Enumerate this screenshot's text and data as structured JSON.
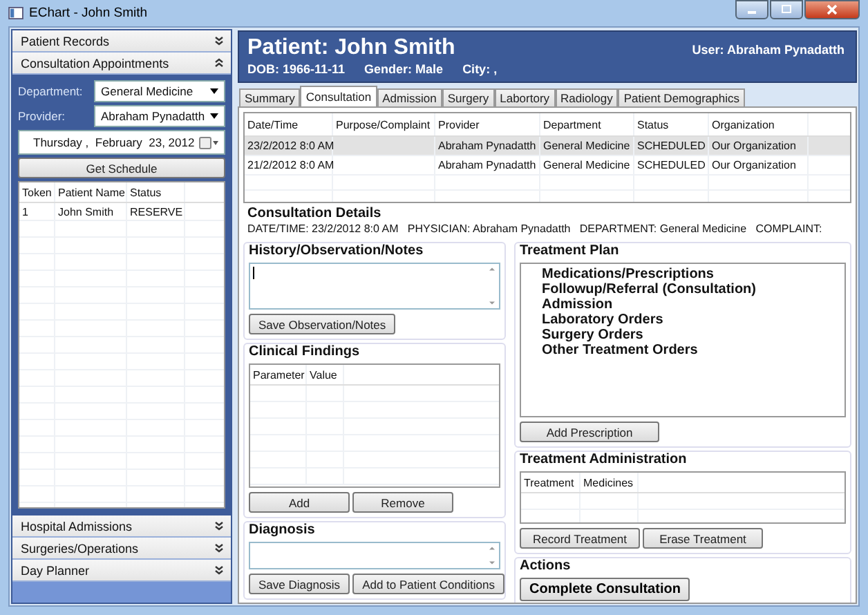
{
  "window": {
    "title": "EChart - John  Smith"
  },
  "sidebar": {
    "sections": [
      {
        "label": "Patient Records",
        "expanded": false
      },
      {
        "label": "Consultation Appointments",
        "expanded": true
      },
      {
        "label": "Hospital Admissions",
        "expanded": false
      },
      {
        "label": "Surgeries/Operations",
        "expanded": false
      },
      {
        "label": "Day Planner",
        "expanded": false
      }
    ],
    "department_label": "Department:",
    "department": "General Medicine",
    "provider_label": "Provider:",
    "provider": "Abraham Pynadatth",
    "date": "Thursday ,  February  23, 2012",
    "get_schedule": "Get Schedule",
    "appointments": {
      "columns": [
        "Token",
        "Patient Name",
        "Status"
      ],
      "rows": [
        {
          "cells": [
            "1",
            "John  Smith",
            "RESERVE"
          ],
          "selected": false
        }
      ]
    }
  },
  "header": {
    "patient": "Patient: John  Smith",
    "user": "User: Abraham Pynadatth",
    "dob": "DOB: 1966-11-11",
    "gender": "Gender: Male",
    "city": "City: ,"
  },
  "tabs": [
    {
      "label": "Summary",
      "selected": false
    },
    {
      "label": "Consultation",
      "selected": true
    },
    {
      "label": "Admission",
      "selected": false
    },
    {
      "label": "Surgery",
      "selected": false
    },
    {
      "label": "Labortory",
      "selected": false
    },
    {
      "label": "Radiology",
      "selected": false
    },
    {
      "label": "Patient Demographics",
      "selected": false
    }
  ],
  "consultations": {
    "columns": [
      "Date/Time",
      "Purpose/Complaint",
      "Provider",
      "Department",
      "Status",
      "Organization"
    ],
    "rows": [
      {
        "cells": [
          "23/2/2012 8:0 AM",
          "",
          "Abraham Pynadatth",
          "General Medicine",
          "SCHEDULED",
          "Our Organization"
        ],
        "selected": true
      },
      {
        "cells": [
          "21/2/2012 8:0 AM",
          "",
          "Abraham Pynadatth",
          "General Medicine",
          "SCHEDULED",
          "Our Organization"
        ],
        "selected": false
      }
    ]
  },
  "details": {
    "title": "Consultation Details",
    "line": "DATE/TIME: 23/2/2012 8:0 AM   PHYSICIAN: Abraham Pynadatth   DEPARTMENT: General Medicine   COMPLAINT:"
  },
  "history": {
    "title": "History/Observation/Notes",
    "button": "Save Observation/Notes"
  },
  "clinical": {
    "title": "Clinical Findings",
    "columns": [
      "Parameter",
      "Value"
    ],
    "buttons": [
      "Add",
      "Remove"
    ]
  },
  "diagnosis": {
    "title": "Diagnosis",
    "buttons": [
      "Save Diagnosis",
      "Add to Patient Conditions"
    ]
  },
  "treatment_plan": {
    "title": "Treatment Plan",
    "items": [
      "Medications/Prescriptions",
      "Followup/Referral (Consultation)",
      "Admission",
      "Laboratory Orders",
      "Surgery Orders",
      "Other Treatment Orders"
    ],
    "button": "Add Prescription"
  },
  "treatment_admin": {
    "title": "Treatment Administration",
    "columns": [
      "Treatment",
      "Medicines"
    ],
    "buttons": [
      "Record Treatment",
      "Erase Treatment"
    ]
  },
  "actions": {
    "title": "Actions",
    "button": "Complete Consultation"
  }
}
